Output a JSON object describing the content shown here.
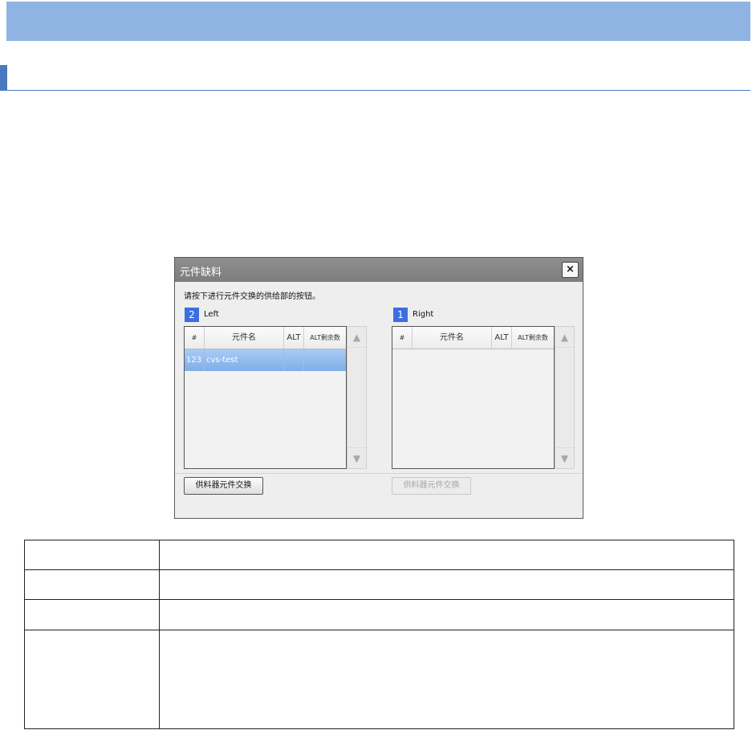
{
  "dialog": {
    "title": "元件缺料",
    "close_label": "×",
    "instruction": "请按下进行元件交换的供给部的按钮。",
    "left": {
      "badge": "2",
      "label": "Left",
      "columns": [
        "#",
        "元件名",
        "ALT",
        "ALT剩余数"
      ],
      "rows": [
        {
          "num": "123",
          "name": "cvs-test",
          "alt": "",
          "alt_remaining": ""
        }
      ],
      "button_label": "供料器元件交换",
      "button_enabled": true
    },
    "right": {
      "badge": "1",
      "label": "Right",
      "columns": [
        "#",
        "元件名",
        "ALT",
        "ALT剩余数"
      ],
      "rows": [],
      "button_label": "供料器元件交换",
      "button_enabled": false
    },
    "scroll_up_icon": "arrow-up-icon",
    "scroll_down_icon": "arrow-down-icon"
  },
  "info_table": {
    "rows": [
      {
        "key": "",
        "value": ""
      },
      {
        "key": "",
        "value": ""
      },
      {
        "key": "",
        "value": ""
      },
      {
        "key": "",
        "value": ""
      }
    ]
  },
  "colors": {
    "top_band": "#8fb4e3",
    "accent": "#4a78bf",
    "badge": "#3b6fe0",
    "selected_row": "#8fb8ee",
    "titlebar": "#868686"
  }
}
